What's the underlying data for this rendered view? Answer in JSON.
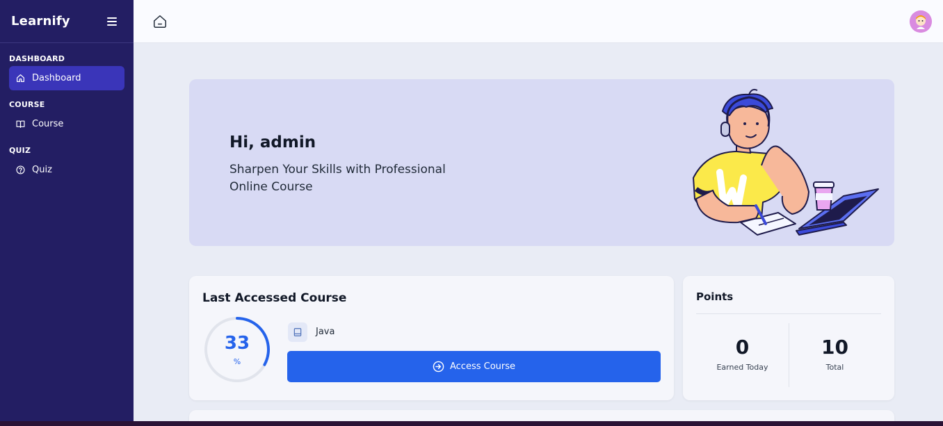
{
  "sidebar": {
    "brand": "Learnify",
    "sections": [
      {
        "label": "DASHBOARD",
        "item": "Dashboard"
      },
      {
        "label": "COURSE",
        "item": "Course"
      },
      {
        "label": "QUIZ",
        "item": "Quiz"
      }
    ],
    "active_item": "Dashboard"
  },
  "hero": {
    "greeting": "Hi, admin",
    "subtitle": "Sharpen Your Skills with Professional Online Course"
  },
  "last_course": {
    "title": "Last Accessed Course",
    "progress": 33,
    "progress_unit": "%",
    "course_name": "Java",
    "button_label": "Access Course"
  },
  "points": {
    "title": "Points",
    "earned_today": {
      "value": "0",
      "label": "Earned Today"
    },
    "total": {
      "value": "10",
      "label": "Total"
    }
  },
  "colors": {
    "sidebar": "#231e63",
    "active_nav": "#3a35b9",
    "primary": "#2563eb",
    "hero_bg": "#d8daf4"
  },
  "icons": {
    "menu": "hamburger-icon",
    "home": "home-icon",
    "dashboard": "house-icon",
    "course": "book-open-icon",
    "quiz": "question-circle-icon",
    "course_item": "book-icon",
    "access": "arrow-circle-right-icon"
  }
}
